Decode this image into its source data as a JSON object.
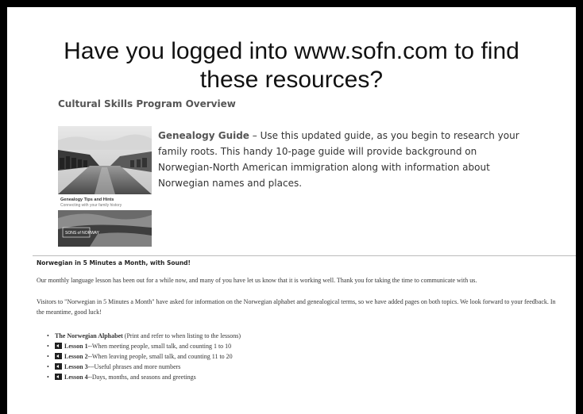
{
  "headline": {
    "line1": "Have you logged into www.sofn.com to find",
    "line2": "these resources?"
  },
  "overview_title": "Cultural Skills Program Overview",
  "guide": {
    "cover_title": "Genealogy Tips and Hints",
    "cover_subtitle": "Connecting with your family history",
    "cover_logo": "SONS of NORWAY",
    "title": "Genealogy Guide",
    "dash": " – ",
    "description": "Use this updated guide, as you begin to research your family roots. This handy 10-page guide will provide background on Norwegian-North American immigration along with information about Norwegian names and places."
  },
  "section": {
    "title": "Norwegian in 5 Minutes a Month, with Sound!",
    "para1": "Our monthly language lesson has been out for a while now, and many of you have let us know that it is working well. Thank you for taking the time to communicate with us.",
    "para2": "Visitors to \"Norwegian in 5 Minutes a Month\" have asked for information on the Norwegian alphabet and genealogical terms, so we have added pages on both topics. We look forward to your feedback. In the meantime, good luck!"
  },
  "lessons": [
    {
      "label": "The Norwegian Alphabet",
      "note": " (Print and refer to when listing to the lessons)",
      "audio": false
    },
    {
      "label": "Lesson 1",
      "note": "--When meeting people, small talk, and counting 1 to 10",
      "audio": true
    },
    {
      "label": "Lesson 2",
      "note": "--When leaving people, small talk, and counting 11 to 20",
      "audio": true
    },
    {
      "label": "Lesson 3",
      "note": "---Useful phrases and more numbers",
      "audio": true
    },
    {
      "label": "Lesson 4",
      "note": "--Days, months, and seasons and greetings",
      "audio": true
    }
  ],
  "icons": {
    "bullet": "•",
    "speaker": "speaker-icon"
  }
}
